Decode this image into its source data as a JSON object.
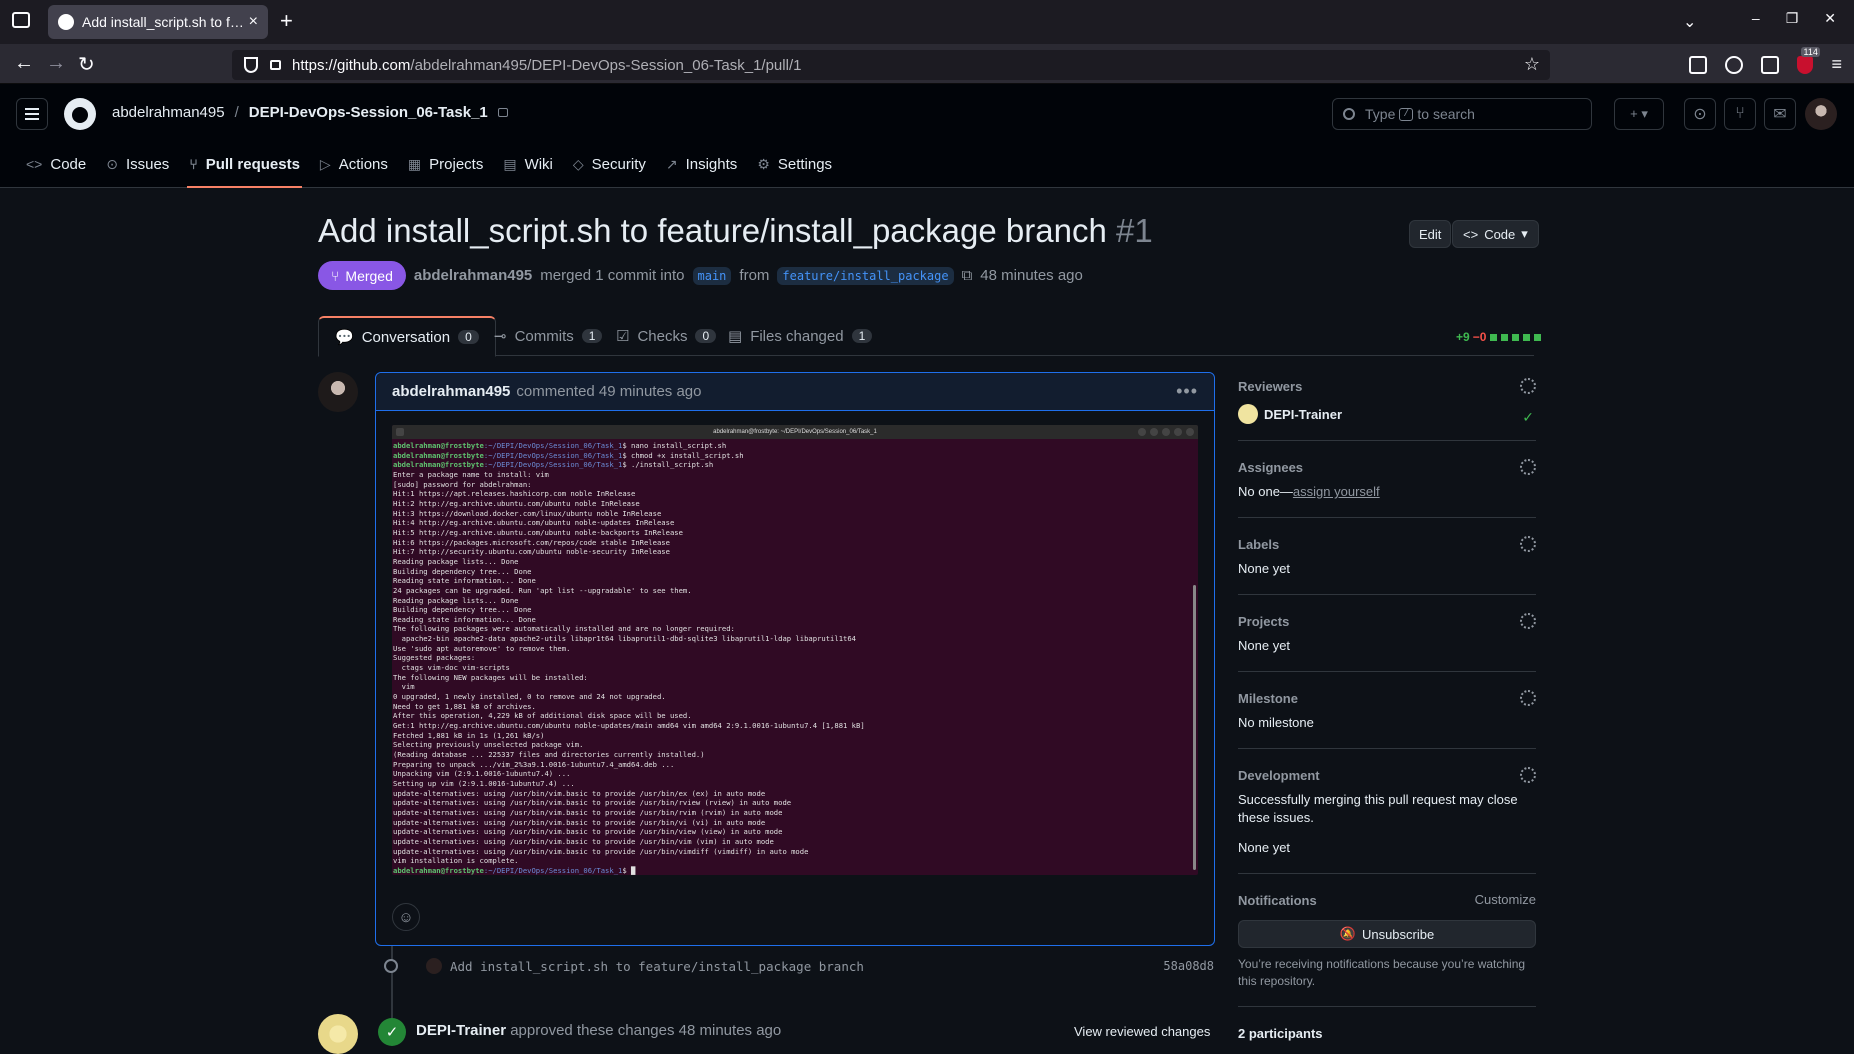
{
  "browser": {
    "tab_title": "Add install_script.sh to f…",
    "url_prefix": "https://github.com",
    "url_path": "/abdelrahman495/DEPI-DevOps-Session_06-Task_1/pull/1",
    "ublock_count": "114"
  },
  "repo": {
    "owner": "abdelrahman495",
    "sep": "/",
    "name": "DEPI-DevOps-Session_06-Task_1"
  },
  "search": {
    "prefix": "Type",
    "key": "/",
    "suffix": "to search"
  },
  "repo_tabs": [
    {
      "label": "Code",
      "icon": "<>"
    },
    {
      "label": "Issues",
      "icon": "⊙"
    },
    {
      "label": "Pull requests",
      "icon": "⑂"
    },
    {
      "label": "Actions",
      "icon": "▷"
    },
    {
      "label": "Projects",
      "icon": "▦"
    },
    {
      "label": "Wiki",
      "icon": "▤"
    },
    {
      "label": "Security",
      "icon": "◇"
    },
    {
      "label": "Insights",
      "icon": "↗"
    },
    {
      "label": "Settings",
      "icon": "⚙"
    }
  ],
  "pr": {
    "title": "Add install_script.sh to feature/install_package branch",
    "number": "#1",
    "edit_label": "Edit",
    "code_label": "Code",
    "status": "Merged",
    "author": "abdelrahman495",
    "merged_text": "merged 1 commit into",
    "base": "main",
    "from_text": "from",
    "head": "feature/install_package",
    "time": "48 minutes ago"
  },
  "pr_tabs": [
    {
      "label": "Conversation",
      "count": "0"
    },
    {
      "label": "Commits",
      "count": "1"
    },
    {
      "label": "Checks",
      "count": "0"
    },
    {
      "label": "Files changed",
      "count": "1"
    }
  ],
  "diffstat": {
    "additions": "+9",
    "deletions": "−0"
  },
  "comment": {
    "author": "abdelrahman495",
    "text": "commented 49 minutes ago",
    "terminal_title": "abdelrahman@frostbyte: ~/DEPI/DevOps/Session_06/Task_1",
    "terminal_prompt_user": "abdelrahman@frostbyte",
    "terminal_prompt_path": ":~/DEPI/DevOps/Session_06/Task_1",
    "terminal_lines": [
      "$ nano install_script.sh",
      "$ chmod +x install_script.sh",
      "$ ./install_script.sh",
      "Enter a package name to install: vim",
      "[sudo] password for abdelrahman:",
      "Hit:1 https://apt.releases.hashicorp.com noble InRelease",
      "Hit:2 http://eg.archive.ubuntu.com/ubuntu noble InRelease",
      "Hit:3 https://download.docker.com/linux/ubuntu noble InRelease",
      "Hit:4 http://eg.archive.ubuntu.com/ubuntu noble-updates InRelease",
      "Hit:5 http://eg.archive.ubuntu.com/ubuntu noble-backports InRelease",
      "Hit:6 https://packages.microsoft.com/repos/code stable InRelease",
      "Hit:7 http://security.ubuntu.com/ubuntu noble-security InRelease",
      "Reading package lists... Done",
      "Building dependency tree... Done",
      "Reading state information... Done",
      "24 packages can be upgraded. Run 'apt list --upgradable' to see them.",
      "Reading package lists... Done",
      "Building dependency tree... Done",
      "Reading state information... Done",
      "The following packages were automatically installed and are no longer required:",
      "  apache2-bin apache2-data apache2-utils libapr1t64 libaprutil1-dbd-sqlite3 libaprutil1-ldap libaprutil1t64",
      "Use 'sudo apt autoremove' to remove them.",
      "Suggested packages:",
      "  ctags vim-doc vim-scripts",
      "The following NEW packages will be installed:",
      "  vim",
      "0 upgraded, 1 newly installed, 0 to remove and 24 not upgraded.",
      "Need to get 1,881 kB of archives.",
      "After this operation, 4,229 kB of additional disk space will be used.",
      "Get:1 http://eg.archive.ubuntu.com/ubuntu noble-updates/main amd64 vim amd64 2:9.1.0016-1ubuntu7.4 [1,881 kB]",
      "Fetched 1,881 kB in 1s (1,261 kB/s)",
      "Selecting previously unselected package vim.",
      "(Reading database ... 225337 files and directories currently installed.)",
      "Preparing to unpack .../vim_2%3a9.1.0016-1ubuntu7.4_amd64.deb ...",
      "Unpacking vim (2:9.1.0016-1ubuntu7.4) ...",
      "Setting up vim (2:9.1.0016-1ubuntu7.4) ...",
      "update-alternatives: using /usr/bin/vim.basic to provide /usr/bin/ex (ex) in auto mode",
      "update-alternatives: using /usr/bin/vim.basic to provide /usr/bin/rview (rview) in auto mode",
      "update-alternatives: using /usr/bin/vim.basic to provide /usr/bin/rvim (rvim) in auto mode",
      "update-alternatives: using /usr/bin/vim.basic to provide /usr/bin/vi (vi) in auto mode",
      "update-alternatives: using /usr/bin/vim.basic to provide /usr/bin/view (view) in auto mode",
      "update-alternatives: using /usr/bin/vim.basic to provide /usr/bin/vim (vim) in auto mode",
      "update-alternatives: using /usr/bin/vim.basic to provide /usr/bin/vimdiff (vimdiff) in auto mode",
      "vim installation is complete.",
      "$ █"
    ]
  },
  "commit": {
    "message": "Add install_script.sh to feature/install_package branch",
    "sha": "58a08d8"
  },
  "approval": {
    "reviewer": "DEPI-Trainer",
    "text": "approved these changes 48 minutes ago",
    "view_label": "View reviewed changes"
  },
  "sidebar": {
    "reviewers": {
      "title": "Reviewers",
      "name": "DEPI-Trainer"
    },
    "assignees": {
      "title": "Assignees",
      "none": "No one—",
      "link": "assign yourself"
    },
    "labels": {
      "title": "Labels",
      "value": "None yet"
    },
    "projects": {
      "title": "Projects",
      "value": "None yet"
    },
    "milestone": {
      "title": "Milestone",
      "value": "No milestone"
    },
    "development": {
      "title": "Development",
      "desc": "Successfully merging this pull request may close these issues.",
      "value": "None yet"
    },
    "notifications": {
      "title": "Notifications",
      "customize": "Customize",
      "unsubscribe": "Unsubscribe",
      "note": "You’re receiving notifications because you’re watching this repository."
    },
    "participants": "2 participants"
  }
}
